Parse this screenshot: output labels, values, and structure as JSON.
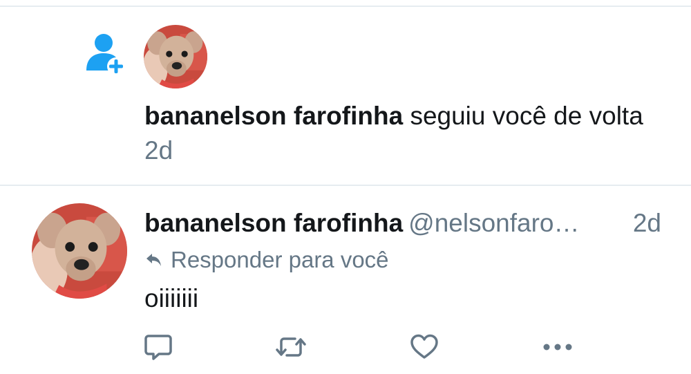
{
  "colors": {
    "accent": "#1da1f2",
    "text": "#14171a",
    "muted": "#657786",
    "divider": "#e6ecf0"
  },
  "notification": {
    "icon": "follow-user-icon",
    "user_name": "bananelson farofinha",
    "action_text": "seguiu você de volta",
    "time": "2d"
  },
  "tweet": {
    "user_name": "bananelson farofinha",
    "handle": "@nelsonfaro…",
    "time": "2d",
    "reply_prefix_icon": "reply-arrow-icon",
    "reply_text": "Responder para você",
    "body": "oiiiiiii",
    "actions": [
      {
        "name": "reply",
        "icon": "comment-icon"
      },
      {
        "name": "retweet",
        "icon": "retweet-icon"
      },
      {
        "name": "like",
        "icon": "heart-icon"
      },
      {
        "name": "more",
        "icon": "more-icon"
      }
    ]
  }
}
